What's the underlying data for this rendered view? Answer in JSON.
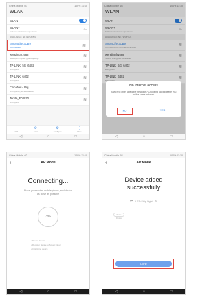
{
  "phone1": {
    "status": {
      "carrier": "China Mobile 4G",
      "right": "100% 11:10"
    },
    "title": "WLAN",
    "wlan_label": "WLAN",
    "wlan_plus": {
      "label": "WLAN+",
      "sub": "Enhanced Internet experience",
      "value": "On"
    },
    "section": "AVAILABLE NETWORKS",
    "networks": [
      {
        "name": "SmartLife-3CB9",
        "status": "Connected"
      },
      {
        "name": "wendingfr1688",
        "status": "Saved, encrypted (good quality)"
      },
      {
        "name": "TP-LINK_5G_6402",
        "status": "Encrypted"
      },
      {
        "name": "TP-LINK_6402",
        "status": "Encrypted"
      },
      {
        "name": "ChinaNet-LR6j",
        "status": "Encrypted (WPS available)"
      },
      {
        "name": "Tenda_F03930",
        "status": "Encrypted"
      }
    ],
    "tabs": [
      "Add",
      "Scan",
      "Configure",
      "More"
    ]
  },
  "phone2": {
    "status": {
      "carrier": "China Mobile 4G",
      "right": "100% 11:10"
    },
    "title": "WLAN",
    "wlan_label": "WLAN",
    "wlan_plus": {
      "label": "WLAN+",
      "sub": "Enhanced Internet experience",
      "value": "On"
    },
    "section": "AVAILABLE NETWORKS",
    "networks": [
      {
        "name": "SmartLife-3CB9",
        "status": "Connected but no Internet access"
      },
      {
        "name": "wendingfr1688",
        "status": "Saved, encrypted (available)"
      },
      {
        "name": "TP-LINK_5G_6402",
        "status": "Encrypted"
      },
      {
        "name": "TP-LINK_6402",
        "status": "Encrypted"
      }
    ],
    "dialog": {
      "title": "No Internet access",
      "message": "Switch to other available networks? Choosing No will leave you on the same network.",
      "no": "NO",
      "yes": "YES"
    }
  },
  "phone3": {
    "status": {
      "carrier": "China Mobile 4G",
      "right": "100% 11:10"
    },
    "header": "AP Mode",
    "title": "Connecting...",
    "message": "Place your router, mobile phone, and device as close as possible",
    "progress_percent": 3,
    "progress_label": "3%",
    "steps": [
      "Device found",
      "Register device to Smart Cloud",
      "Initializing device"
    ]
  },
  "phone4": {
    "status": {
      "carrier": "China Mobile 4G",
      "right": "100% 11:10"
    },
    "header": "AP Mode",
    "title": "Device added successfully",
    "device_name": "LED Strip Light",
    "mini_button": "Share Device",
    "done": "Done"
  }
}
